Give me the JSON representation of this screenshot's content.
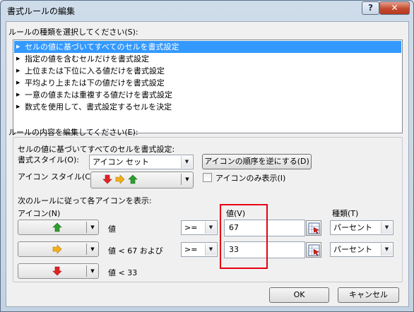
{
  "window": {
    "title": "書式ルールの編集",
    "help_label": "?",
    "close_label": "✕"
  },
  "rule_type": {
    "label": "ルールの種類を選択してください(S):",
    "items": [
      "セルの値に基づいてすべてのセルを書式設定",
      "指定の値を含むセルだけを書式設定",
      "上位または下位に入る値だけを書式設定",
      "平均より上または下の値だけを書式設定",
      "一意の値または重複する値だけを書式設定",
      "数式を使用して、書式設定するセルを決定"
    ],
    "selected_index": 0
  },
  "rule_edit": {
    "label": "ルールの内容を編集してください(E):",
    "description": "セルの値に基づいてすべてのセルを書式設定:",
    "format_style_label": "書式スタイル(O):",
    "format_style_value": "アイコン セット",
    "reverse_button": "アイコンの順序を逆にする(D)",
    "icon_style_label": "アイコン スタイル(C):",
    "icon_only_label": "アイコンのみ表示(I)",
    "icon_only_checked": false,
    "rules_caption": "次のルールに従って各アイコンを表示:",
    "icon_col": "アイコン(N)",
    "value_col": "値(V)",
    "type_col": "種類(T)",
    "rows": [
      {
        "icon": "green-up-arrow-icon",
        "condition": "値",
        "operator": ">=",
        "value": "67",
        "type": "パーセント"
      },
      {
        "icon": "yellow-right-arrow-icon",
        "condition": "値 < 67 および",
        "operator": ">=",
        "value": "33",
        "type": "パーセント"
      },
      {
        "icon": "red-down-arrow-icon",
        "condition": "値 < 33"
      }
    ]
  },
  "footer": {
    "ok": "OK",
    "cancel": "キャンセル"
  },
  "colors": {
    "green_arrow": "#2e9e2e",
    "yellow_arrow": "#f2b01e",
    "red_arrow": "#e02424",
    "selection": "#3399ff",
    "highlight_box": "#e60012"
  }
}
